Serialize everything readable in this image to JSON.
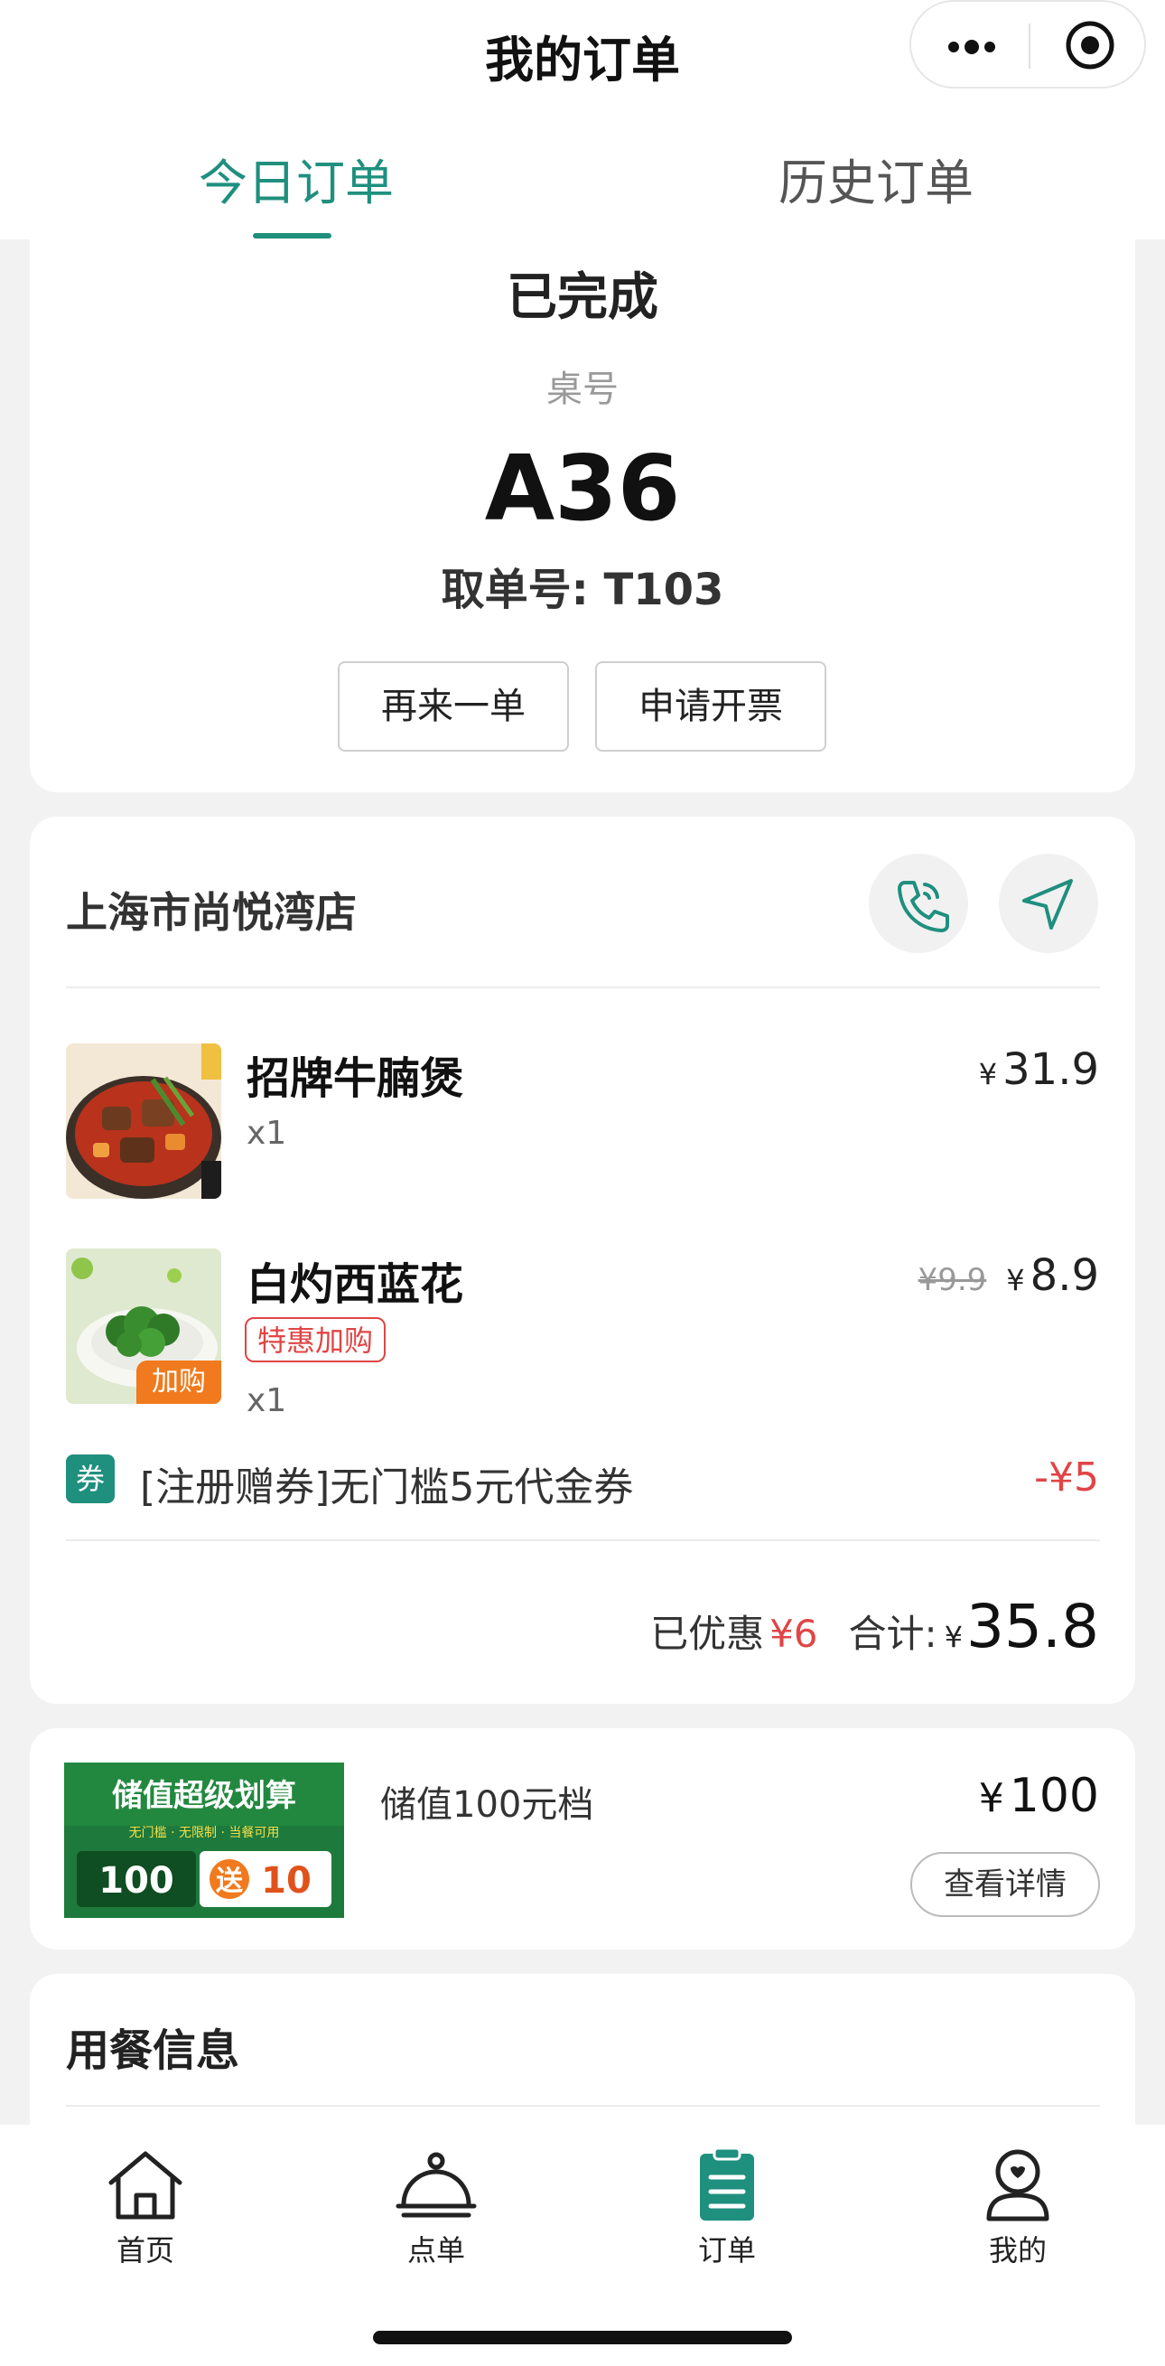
{
  "header": {
    "title": "我的订单",
    "tabs": [
      {
        "label": "今日订单",
        "active": true
      },
      {
        "label": "历史订单",
        "active": false
      }
    ],
    "icons": [
      "more-dots-icon",
      "capsule-close-icon"
    ]
  },
  "order": {
    "status": "已完成",
    "table_label": "桌号",
    "table_no": "A36",
    "pickup": "取单号: T103",
    "buttons": {
      "reorder": "再来一单",
      "invoice": "申请开票"
    }
  },
  "store": {
    "name": "上海市尚悦湾店",
    "icons": [
      "phone-icon",
      "navigate-icon"
    ]
  },
  "items": [
    {
      "name": "招牌牛腩煲",
      "qty": "x1",
      "currency": "¥",
      "price": "31.9"
    },
    {
      "name": "白灼西蓝花",
      "qty": "x1",
      "currency": "¥",
      "price": "8.9",
      "original_price": "¥9.9",
      "tag": "特惠加购",
      "badge": "加购"
    }
  ],
  "coupon": {
    "icon_text": "券",
    "text": "[注册赠券]无门槛5元代金券",
    "amount": "-¥5"
  },
  "summary": {
    "discount_label": "已优惠",
    "discount_value": "¥6",
    "total_label": "合计:",
    "total_currency": "¥",
    "total_value": "35.8"
  },
  "stored_value": {
    "banner_title": "储值超级划算",
    "banner_sub": "无门槛 · 无限制 · 当餐可用",
    "banner_amount": "100",
    "banner_gift_prefix": "送",
    "banner_gift": "10",
    "text": "储值100元档",
    "currency": "¥",
    "price": "100",
    "detail_button": "查看详情"
  },
  "dining": {
    "title": "用餐信息"
  },
  "tabbar": {
    "items": [
      {
        "label": "首页",
        "icon": "home-icon"
      },
      {
        "label": "点单",
        "icon": "cloche-icon"
      },
      {
        "label": "订单",
        "icon": "clipboard-icon",
        "active": true
      },
      {
        "label": "我的",
        "icon": "profile-icon"
      }
    ]
  },
  "colors": {
    "accent": "#1f8f7e",
    "red": "#e04545",
    "orange": "#f07a1d"
  }
}
